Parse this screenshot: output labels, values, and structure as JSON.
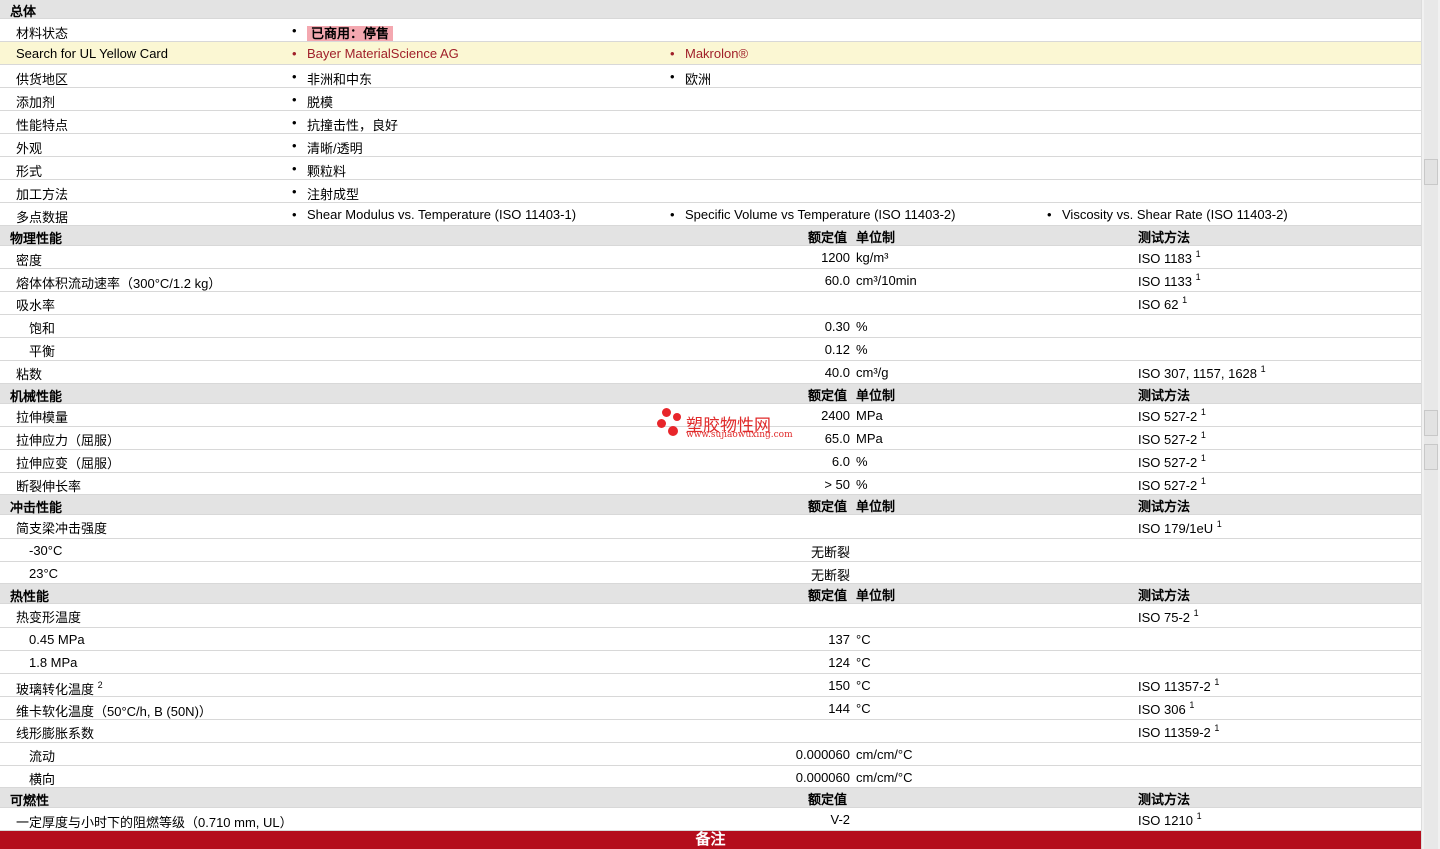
{
  "general": {
    "title": "总体",
    "status_label": "材料状态",
    "status_badge": "已商用：停售",
    "yellow_card_label": "Search for UL Yellow Card",
    "supplier": "Bayer MaterialScience AG",
    "brand": "Makrolon®",
    "region_label": "供货地区",
    "region_1": "非洲和中东",
    "region_2": "欧洲",
    "additive_label": "添加剂",
    "additive": "脱模",
    "feature_label": "性能特点",
    "feature": "抗撞击性，良好",
    "appearance_label": "外观",
    "appearance": "清晰/透明",
    "form_label": "形式",
    "form": "颗粒料",
    "process_label": "加工方法",
    "process": "注射成型",
    "multipoint_label": "多点数据",
    "multipoint_1": "Shear Modulus vs. Temperature (ISO 11403-1)",
    "multipoint_2": "Specific Volume vs Temperature (ISO 11403-2)",
    "multipoint_3": "Viscosity vs. Shear Rate (ISO 11403-2)"
  },
  "headers": {
    "rated": "额定值",
    "unit": "单位制",
    "test": "测试方法"
  },
  "physical": {
    "title": "物理性能",
    "density_label": "密度",
    "density_val": "1200",
    "density_unit": "kg/m³",
    "density_test": "ISO 1183",
    "mvr_label": "熔体体积流动速率（300°C/1.2 kg）",
    "mvr_val": "60.0",
    "mvr_unit": "cm³/10min",
    "mvr_test": "ISO 1133",
    "water_label": "吸水率",
    "water_test": "ISO 62",
    "sat_label": "饱和",
    "sat_val": "0.30",
    "sat_unit": "%",
    "eq_label": "平衡",
    "eq_val": "0.12",
    "eq_unit": "%",
    "visc_label": "粘数",
    "visc_val": "40.0",
    "visc_unit": "cm³/g",
    "visc_test": "ISO 307, 1157, 1628"
  },
  "mechanical": {
    "title": "机械性能",
    "mod_label": "拉伸模量",
    "mod_val": "2400",
    "mod_unit": "MPa",
    "mod_test": "ISO 527-2",
    "stress_label": "拉伸应力（屈服）",
    "stress_val": "65.0",
    "stress_unit": "MPa",
    "stress_test": "ISO 527-2",
    "strain_label": "拉伸应变（屈服）",
    "strain_val": "6.0",
    "strain_unit": "%",
    "strain_test": "ISO 527-2",
    "elong_label": "断裂伸长率",
    "elong_val": "> 50",
    "elong_unit": "%",
    "elong_test": "ISO 527-2"
  },
  "impact": {
    "title": "冲击性能",
    "charpy_label": "简支梁冲击强度",
    "charpy_test": "ISO 179/1eU",
    "m30_label": "-30°C",
    "m30_val": "无断裂",
    "t23_label": "23°C",
    "t23_val": "无断裂"
  },
  "thermal": {
    "title": "热性能",
    "hdt_label": "热变形温度",
    "hdt_test": "ISO 75-2",
    "hdt1_label": "0.45 MPa",
    "hdt1_val": "137",
    "hdt1_unit": "°C",
    "hdt2_label": "1.8 MPa",
    "hdt2_val": "124",
    "hdt2_unit": "°C",
    "tg_label": "玻璃转化温度",
    "tg_note": "2",
    "tg_val": "150",
    "tg_unit": "°C",
    "tg_test": "ISO 11357-2",
    "vicat_label": "维卡软化温度（50°C/h, B (50N)）",
    "vicat_val": "144",
    "vicat_unit": "°C",
    "vicat_test": "ISO 306",
    "clte_label": "线形膨胀系数",
    "clte_test": "ISO 11359-2",
    "flow_label": "流动",
    "flow_val": "0.000060",
    "flow_unit": "cm/cm/°C",
    "trans_label": "横向",
    "trans_val": "0.000060",
    "trans_unit": "cm/cm/°C"
  },
  "flammability": {
    "title": "可燃性",
    "ul_label": "一定厚度与小时下的阻燃等级（0.710 mm, UL）",
    "ul_val": "V-2",
    "ul_test": "ISO 1210"
  },
  "note_ref": "1",
  "notes_bar": "备注",
  "watermark": {
    "title": "塑胶物性网",
    "url": "www.sujiaowuxing.com"
  }
}
